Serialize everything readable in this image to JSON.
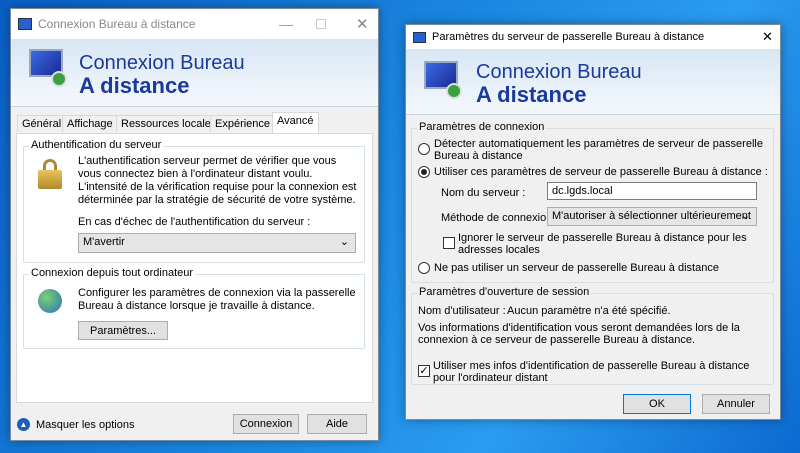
{
  "left": {
    "title": "Connexion Bureau à distance",
    "banner": {
      "line1": "Connexion Bureau",
      "line2": "A distance"
    },
    "tabs": [
      {
        "label": "Général"
      },
      {
        "label": "Affichage"
      },
      {
        "label": "Ressources locales"
      },
      {
        "label": "Expérience"
      },
      {
        "label": "Avancé"
      }
    ],
    "auth": {
      "title": "Authentification du serveur",
      "desc": "L'authentification serveur permet de vérifier que vous vous connectez bien à l'ordinateur distant voulu. L'intensité de la vérification requise pour la connexion est déterminée par la stratégie de sécurité de votre système.",
      "fail_label": "En cas d'échec de l'authentification du serveur :",
      "fail_value": "M'avertir"
    },
    "anywhere": {
      "title": "Connexion depuis tout ordinateur",
      "desc": "Configurer les paramètres de connexion via la passerelle Bureau à distance lorsque je travaille à distance.",
      "button": "Paramètres..."
    },
    "hide_options": "Masquer les options",
    "connect": "Connexion",
    "help": "Aide"
  },
  "right": {
    "title": "Paramètres du serveur de passerelle Bureau à distance",
    "banner": {
      "line1": "Connexion Bureau",
      "line2": "A distance"
    },
    "conn": {
      "title": "Paramètres de connexion",
      "auto": "Détecter automatiquement les paramètres de serveur de passerelle Bureau à distance",
      "use": "Utiliser ces paramètres de serveur de passerelle Bureau à distance :",
      "server_label": "Nom du serveur :",
      "server_value": "dc.lgds.local",
      "method_label": "Méthode de connexion :",
      "method_value": "M'autoriser à sélectionner ultérieurement",
      "bypass": "Ignorer le serveur de passerelle Bureau à distance pour les adresses locales",
      "none": "Ne pas utiliser un serveur de passerelle Bureau à distance"
    },
    "logon": {
      "title": "Paramètres d'ouverture de session",
      "user_label": "Nom d'utilisateur :",
      "user_value": "Aucun paramètre n'a été spécifié.",
      "info": "Vos informations d'identification vous seront demandées lors de la connexion à ce serveur de passerelle Bureau à distance.",
      "reuse": "Utiliser mes infos d'identification de passerelle Bureau à distance pour l'ordinateur distant"
    },
    "ok": "OK",
    "cancel": "Annuler"
  }
}
